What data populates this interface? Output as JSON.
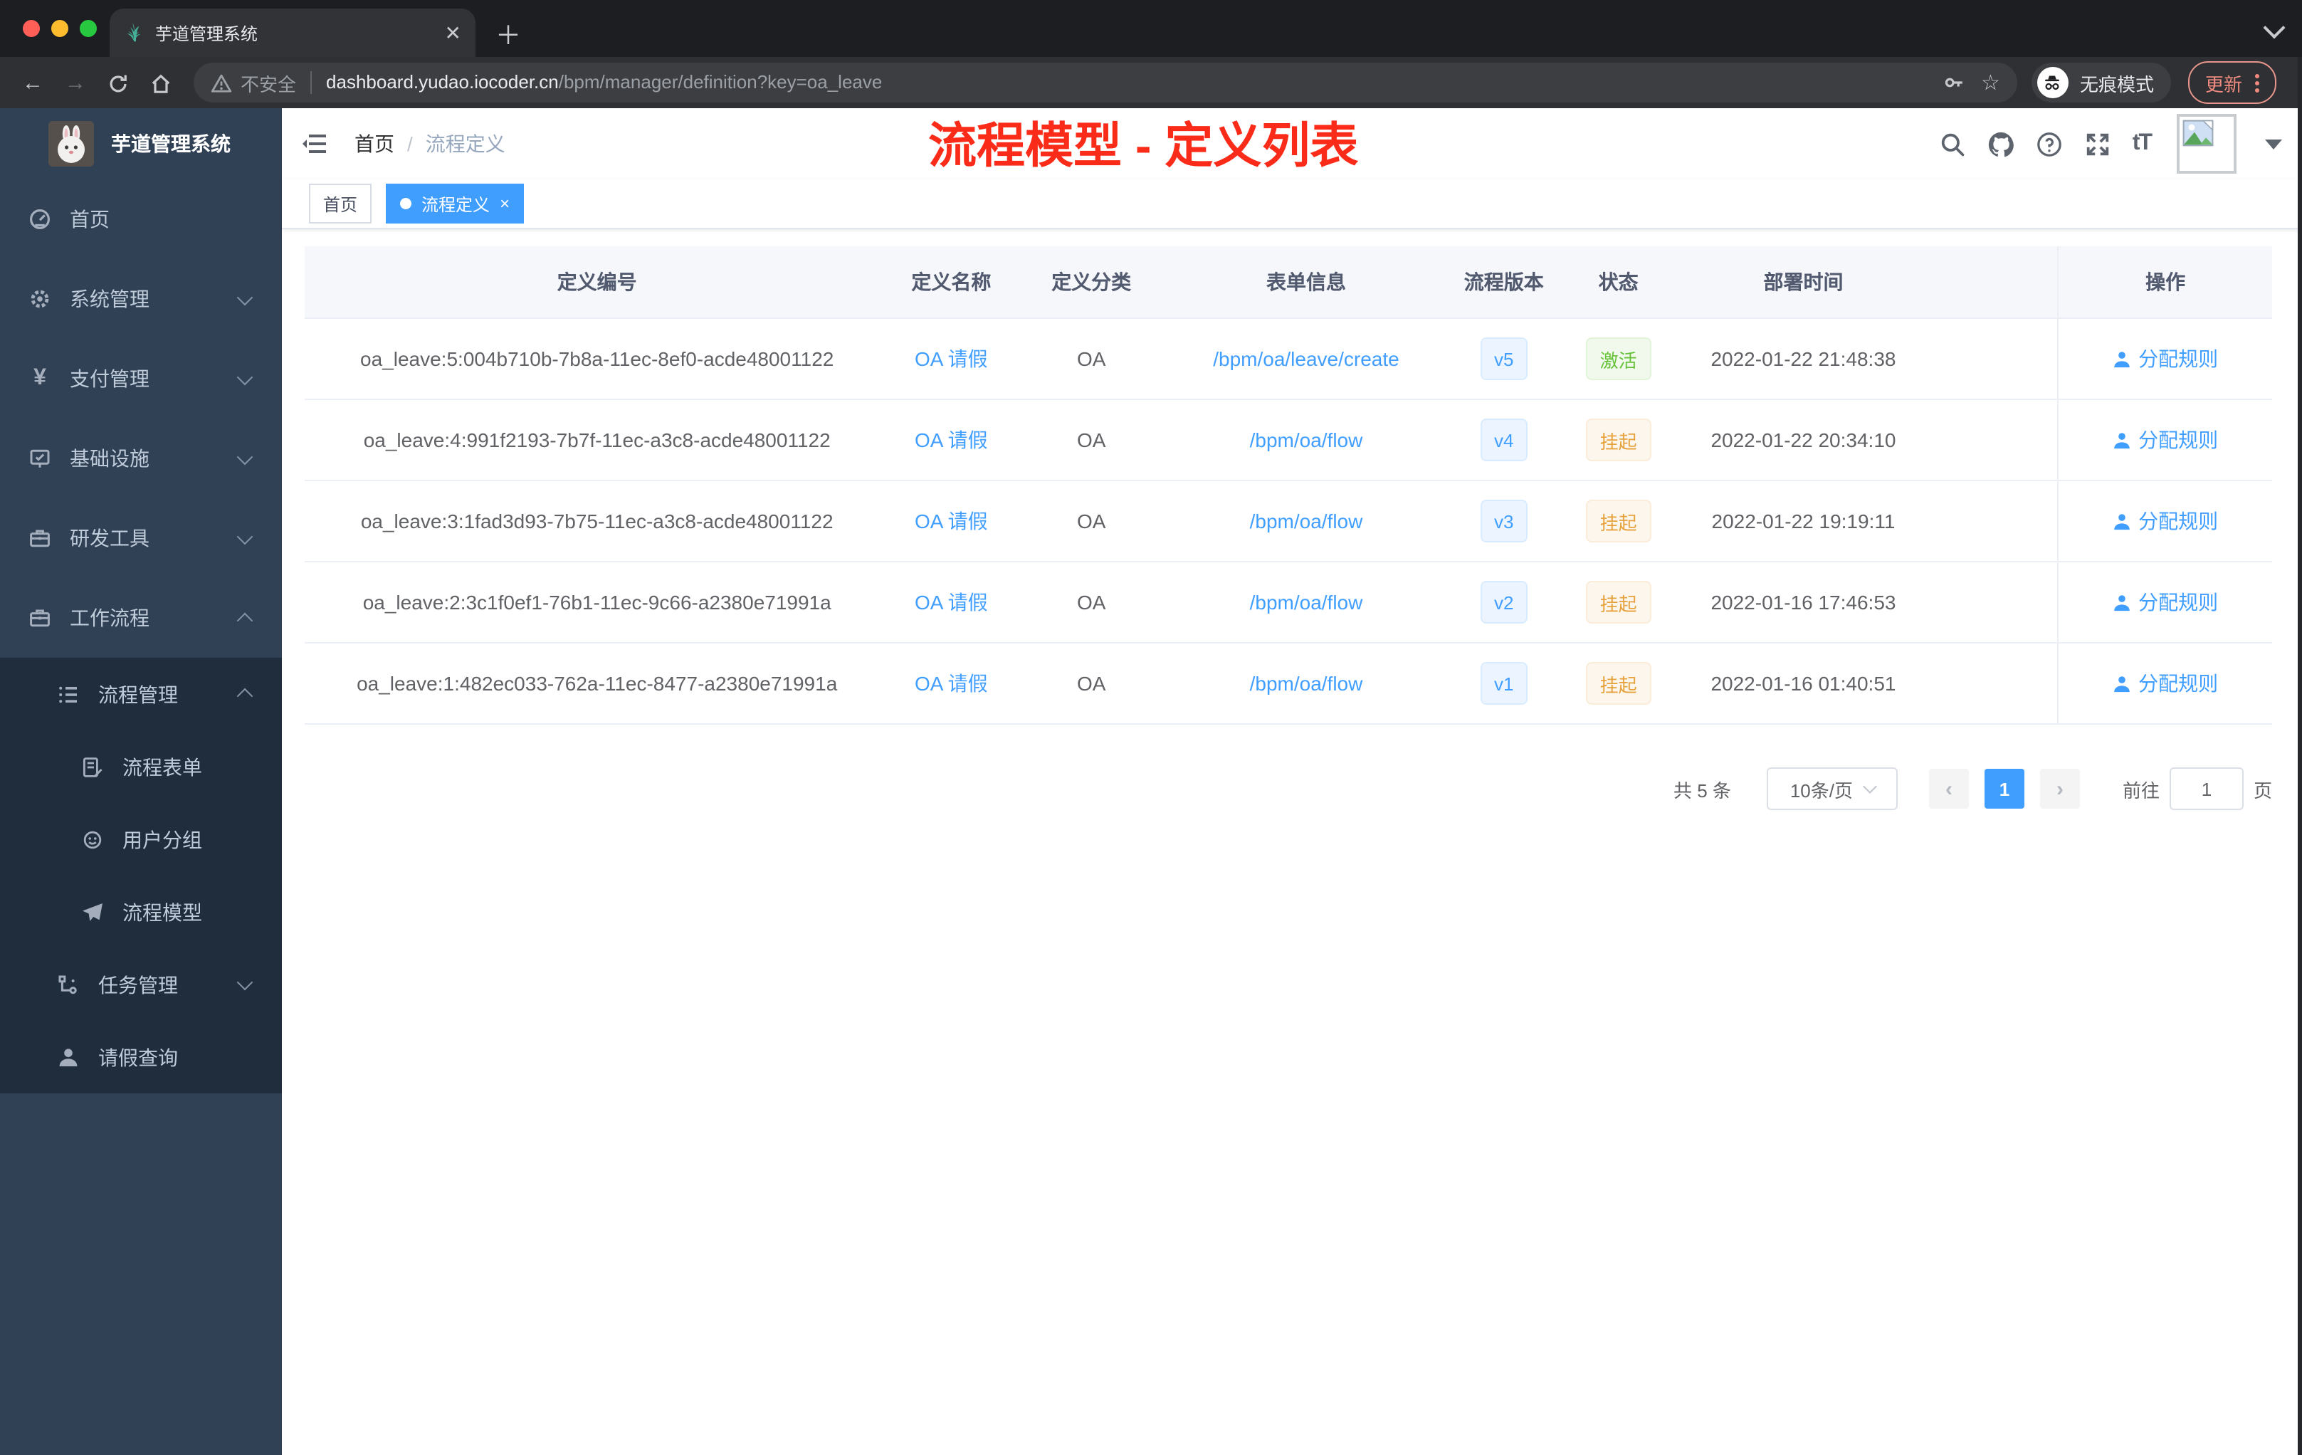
{
  "browser": {
    "tab_title": "芋道管理系统",
    "security_label": "不安全",
    "url_host": "dashboard.yudao.iocoder.cn",
    "url_path": "/bpm/manager/definition?key=oa_leave",
    "incognito_label": "无痕模式",
    "update_label": "更新"
  },
  "sidebar": {
    "logo_title": "芋道管理系统",
    "menu": [
      {
        "label": "首页",
        "icon": "dashboard-icon"
      },
      {
        "label": "系统管理",
        "icon": "gear-icon",
        "chevron": "down"
      },
      {
        "label": "支付管理",
        "icon": "yen-icon",
        "chevron": "down"
      },
      {
        "label": "基础设施",
        "icon": "monitor-icon",
        "chevron": "down"
      },
      {
        "label": "研发工具",
        "icon": "toolbox-icon",
        "chevron": "down"
      },
      {
        "label": "工作流程",
        "icon": "toolbox-icon",
        "chevron": "up"
      }
    ],
    "workflow_submenu": [
      {
        "label": "流程管理",
        "icon": "tree-list-icon",
        "chevron": "up",
        "level": 1
      },
      {
        "label": "流程表单",
        "icon": "form-icon",
        "level": 2
      },
      {
        "label": "用户分组",
        "icon": "people-icon",
        "level": 2
      },
      {
        "label": "流程模型",
        "icon": "send-icon",
        "level": 2
      },
      {
        "label": "任务管理",
        "icon": "tree-icon",
        "chevron": "down",
        "level": 1
      },
      {
        "label": "请假查询",
        "icon": "user-icon",
        "level": 1
      }
    ]
  },
  "header": {
    "breadcrumb": [
      "首页",
      "流程定义"
    ],
    "annotation": "流程模型 - 定义列表"
  },
  "tags": [
    {
      "label": "首页",
      "active": false
    },
    {
      "label": "流程定义",
      "active": true
    }
  ],
  "table": {
    "columns": [
      "定义编号",
      "定义名称",
      "定义分类",
      "表单信息",
      "流程版本",
      "状态",
      "部署时间",
      "操作"
    ],
    "rows": [
      {
        "id": "oa_leave:5:004b710b-7b8a-11ec-8ef0-acde48001122",
        "name": "OA 请假",
        "category": "OA",
        "form": "/bpm/oa/leave/create",
        "version": "v5",
        "status": "激活",
        "status_type": "success",
        "time": "2022-01-22 21:48:38",
        "action": "分配规则"
      },
      {
        "id": "oa_leave:4:991f2193-7b7f-11ec-a3c8-acde48001122",
        "name": "OA 请假",
        "category": "OA",
        "form": "/bpm/oa/flow",
        "version": "v4",
        "status": "挂起",
        "status_type": "warning",
        "time": "2022-01-22 20:34:10",
        "action": "分配规则"
      },
      {
        "id": "oa_leave:3:1fad3d93-7b75-11ec-a3c8-acde48001122",
        "name": "OA 请假",
        "category": "OA",
        "form": "/bpm/oa/flow",
        "version": "v3",
        "status": "挂起",
        "status_type": "warning",
        "time": "2022-01-22 19:19:11",
        "action": "分配规则"
      },
      {
        "id": "oa_leave:2:3c1f0ef1-76b1-11ec-9c66-a2380e71991a",
        "name": "OA 请假",
        "category": "OA",
        "form": "/bpm/oa/flow",
        "version": "v2",
        "status": "挂起",
        "status_type": "warning",
        "time": "2022-01-16 17:46:53",
        "action": "分配规则"
      },
      {
        "id": "oa_leave:1:482ec033-762a-11ec-8477-a2380e71991a",
        "name": "OA 请假",
        "category": "OA",
        "form": "/bpm/oa/flow",
        "version": "v1",
        "status": "挂起",
        "status_type": "warning",
        "time": "2022-01-16 01:40:51",
        "action": "分配规则"
      }
    ]
  },
  "pagination": {
    "total": "共 5 条",
    "page_size": "10条/页",
    "current_page": "1",
    "goto_label": "前往",
    "goto_value": "1",
    "page_unit": "页"
  },
  "colors": {
    "accent": "#409eff",
    "sidebar_bg": "#304156",
    "submenu_bg": "#1f2d3d",
    "success": "#67c23a",
    "warning": "#e6a23c",
    "tag_active_bg": "#409eff",
    "annotation_red": "#fa2c19"
  }
}
